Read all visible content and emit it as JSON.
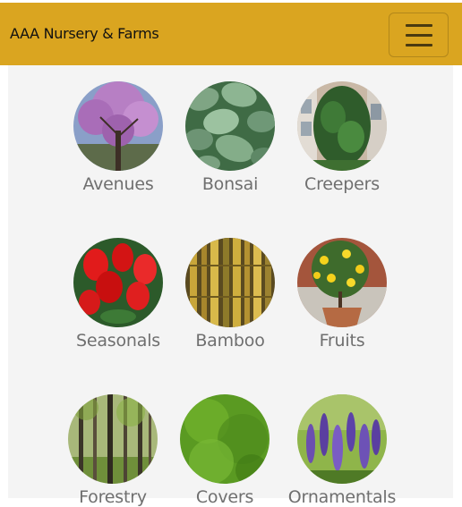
{
  "header": {
    "brand": "AAA Nursery & Farms",
    "menu_icon": "hamburger-menu-icon"
  },
  "categories": [
    {
      "label": "Avenues",
      "image": "purple-flowering-tree"
    },
    {
      "label": "Bonsai",
      "image": "green-leaves"
    },
    {
      "label": "Creepers",
      "image": "climbing-vine-wall"
    },
    {
      "label": "Seasonals",
      "image": "red-flowers"
    },
    {
      "label": "Bamboo",
      "image": "bamboo-stalks"
    },
    {
      "label": "Fruits",
      "image": "potted-lemon-tree"
    },
    {
      "label": "Forestry",
      "image": "forest-trees"
    },
    {
      "label": "Covers",
      "image": "grass-ground-cover"
    },
    {
      "label": "Ornamentals",
      "image": "lavender-flowers"
    }
  ],
  "colors": {
    "navbar": "#daa520",
    "content_bg": "#f4f4f4",
    "label_text": "#6f6f6f"
  }
}
